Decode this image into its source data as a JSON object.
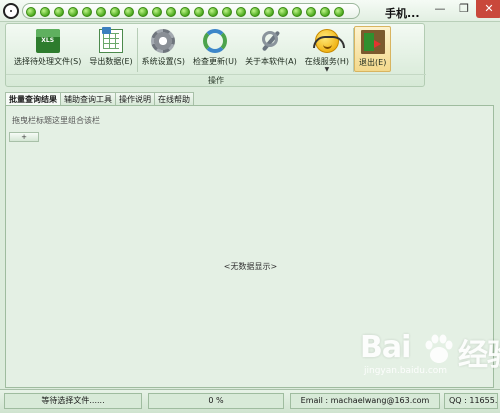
{
  "window": {
    "title": "手机...",
    "quick_access_dot_count": 23,
    "controls": {
      "minimize": "—",
      "restore": "❐",
      "close": "✕"
    }
  },
  "ribbon": {
    "buttons": [
      {
        "name": "select-file-button",
        "icon": "excel-xls-icon",
        "label": "选择待处理文件(S)"
      },
      {
        "name": "export-data-button",
        "icon": "spreadsheet-icon",
        "label": "导出数据(E)"
      },
      {
        "name": "system-settings-button",
        "icon": "gear-icon",
        "label": "系统设置(S)"
      },
      {
        "name": "check-update-button",
        "icon": "refresh-icon",
        "label": "检查更新(U)"
      },
      {
        "name": "about-button",
        "icon": "tools-icon",
        "label": "关于本软件(A)"
      },
      {
        "name": "online-service-button",
        "icon": "headset-face-icon",
        "label": "在线服务(H)"
      },
      {
        "name": "exit-button",
        "icon": "exit-door-icon",
        "label": "退出(E)"
      }
    ],
    "group_label": "操作"
  },
  "tabs": [
    {
      "label": "批量查询结果",
      "active": true
    },
    {
      "label": "辅助查询工具",
      "active": false
    },
    {
      "label": "操作说明",
      "active": false
    },
    {
      "label": "在线帮助",
      "active": false
    }
  ],
  "content": {
    "group_hint": "拖曳栏标题这里组合该栏",
    "expand_glyph": "+",
    "empty_text": "<无数据显示>"
  },
  "statusbar": {
    "status": "等待选择文件......",
    "progress_text": "0 %",
    "progress": 0,
    "email": "Email : machaelwang@163.com",
    "qq": "QQ : 11655..."
  },
  "watermark": {
    "brand": "Bai",
    "brand_suffix": "经验",
    "url": "jingyan.baidu.com"
  }
}
